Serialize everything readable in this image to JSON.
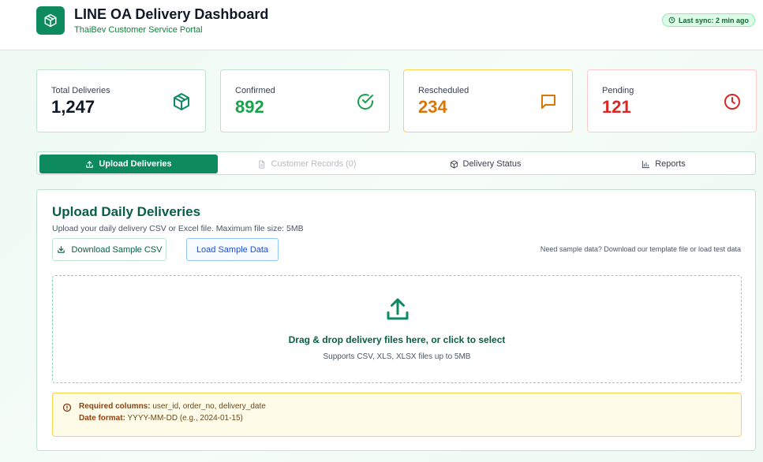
{
  "header": {
    "title": "LINE OA Delivery Dashboard",
    "subtitle": "ThaiBev Customer Service Portal",
    "logo_icon": "package-icon",
    "sync_status": "Last sync: 2 min ago"
  },
  "stats": [
    {
      "label": "Total Deliveries",
      "value": "1,247",
      "icon": "package-icon",
      "color": "#111827",
      "accent": "#0e8a5f",
      "border": "#bfe3cf"
    },
    {
      "label": "Confirmed",
      "value": "892",
      "icon": "check-circle-icon",
      "color": "#16a34a",
      "accent": "#16a34a",
      "border": "#bfe3cf"
    },
    {
      "label": "Rescheduled",
      "value": "234",
      "icon": "chat-bubble-icon",
      "color": "#d97706",
      "accent": "#d97706",
      "border": "#fcd34d"
    },
    {
      "label": "Pending",
      "value": "121",
      "icon": "clock-icon",
      "color": "#dc2626",
      "accent": "#dc2626",
      "border": "#fecaca"
    }
  ],
  "tabs": [
    {
      "label": "Upload Deliveries",
      "icon": "upload-icon",
      "state": "active"
    },
    {
      "label": "Customer Records (0)",
      "icon": "document-icon",
      "state": "disabled"
    },
    {
      "label": "Delivery Status",
      "icon": "package-icon",
      "state": "normal"
    },
    {
      "label": "Reports",
      "icon": "bar-chart-icon",
      "state": "normal"
    }
  ],
  "upload": {
    "title": "Upload Daily Deliveries",
    "description": "Upload your daily delivery CSV or Excel file. Maximum file size: 5MB",
    "download_button": "Download Sample CSV",
    "load_button": "Load Sample Data",
    "helper_text": "Need sample data? Download our template file or load test data",
    "dropzone_title": "Drag & drop delivery files here, or click to select",
    "dropzone_subtitle": "Supports CSV, XLS, XLSX files up to 5MB",
    "note_required_label": "Required columns:",
    "note_required_value": "user_id, order_no, delivery_date",
    "note_format_label": "Date format:",
    "note_format_value": "YYYY-MM-DD (e.g., 2024-01-15)"
  },
  "colors": {
    "brand": "#0e8a5f",
    "brand_dark": "#065f46"
  }
}
